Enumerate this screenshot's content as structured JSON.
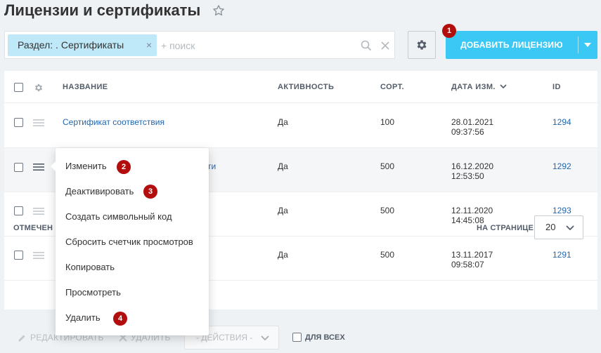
{
  "page": {
    "title": "Лицензии и сертификаты"
  },
  "filter": {
    "chip_label": "Раздел: . Сертификаты",
    "chip_close": "×",
    "search_placeholder": "+ поиск",
    "search_value": ""
  },
  "toolbar": {
    "add_label": "ДОБАВИТЬ ЛИЦЕНЗИЮ"
  },
  "badges": [
    "1",
    "2",
    "3",
    "4"
  ],
  "grid": {
    "columns": [
      "НАЗВАНИЕ",
      "АКТИВНОСТЬ",
      "СОРТ.",
      "ДАТА ИЗМ.",
      "ID"
    ],
    "rows": [
      {
        "name": "Сертификат соответствия",
        "active": "Да",
        "sort": "100",
        "date": "28.01.2021",
        "time": "09:37:56",
        "id": "1294"
      },
      {
        "name": "ти",
        "active": "Да",
        "sort": "500",
        "date": "16.12.2020",
        "time": "12:53:50",
        "id": "1292"
      },
      {
        "name": "",
        "active": "Да",
        "sort": "500",
        "date": "12.11.2020",
        "time": "14:45:08",
        "id": "1293"
      },
      {
        "name": "",
        "active": "Да",
        "sort": "500",
        "date": "13.11.2017",
        "time": "09:58:07",
        "id": "1291"
      }
    ],
    "footer_selected": "ОТМЕЧЕН",
    "per_page_label": "НА СТРАНИЦЕ:",
    "per_page_value": "20"
  },
  "action_panel": {
    "edit": "РЕДАКТИРОВАТЬ",
    "delete": "УДАЛИТЬ",
    "actions_select": "- ДЕЙСТВИЯ -",
    "for_all": "ДЛЯ ВСЕХ"
  },
  "context_menu": {
    "items": [
      "Изменить",
      "Деактивировать",
      "Создать символьный код",
      "Сбросить счетчик просмотров",
      "Копировать",
      "Просмотреть",
      "Удалить"
    ]
  },
  "colors": {
    "accent": "#3bc8f5",
    "badge": "#b30e0e",
    "link": "#2067b0"
  }
}
